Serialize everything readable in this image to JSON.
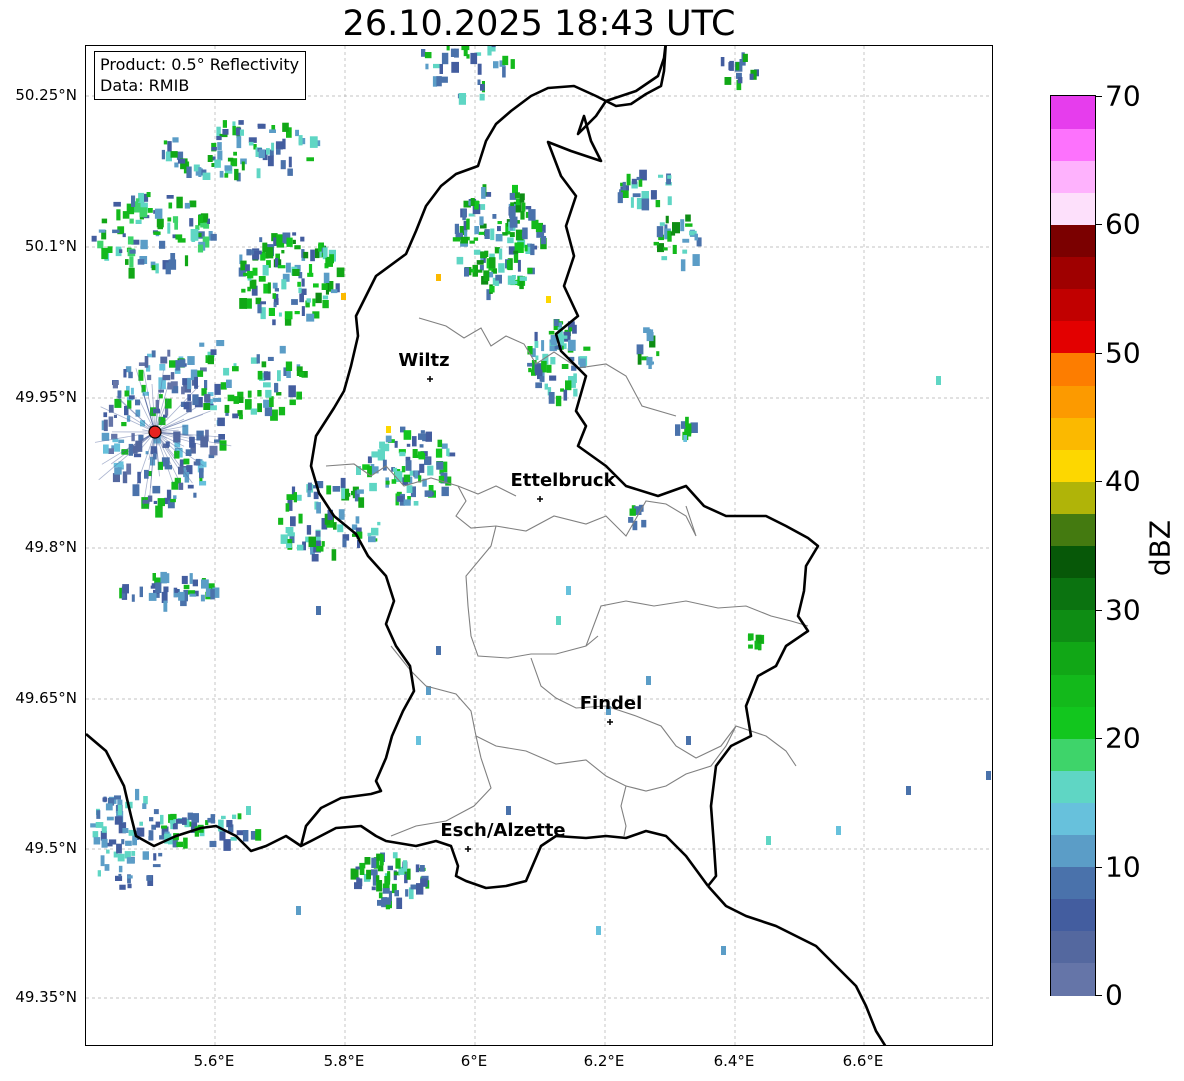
{
  "title": "26.10.2025 18:43 UTC",
  "info": {
    "product": "Product: 0.5° Reflectivity",
    "source": "Data: RMIB"
  },
  "axes": {
    "lat_ticks": [
      "50.25°N",
      "50.1°N",
      "49.95°N",
      "49.8°N",
      "49.65°N",
      "49.5°N",
      "49.35°N"
    ],
    "lon_ticks": [
      "5.6°E",
      "5.8°E",
      "6°E",
      "6.2°E",
      "6.4°E",
      "6.6°E"
    ],
    "grid": true
  },
  "cities": [
    {
      "name": "Wiltz"
    },
    {
      "name": "Ettelbruck"
    },
    {
      "name": "Findel"
    },
    {
      "name": "Esch/Alzette"
    }
  ],
  "radar_site": {
    "color": "#e8231f"
  },
  "colorbar": {
    "label": "dBZ",
    "ticks": [
      "0",
      "10",
      "20",
      "30",
      "40",
      "50",
      "60",
      "70"
    ],
    "range": [
      0,
      70
    ],
    "colors": [
      "#6575a8",
      "#54689f",
      "#435d9f",
      "#4a72ab",
      "#5b9dc7",
      "#67c1dc",
      "#5fd6c4",
      "#3ed46a",
      "#12c61e",
      "#13b91b",
      "#11a716",
      "#0e8d14",
      "#0b7310",
      "#075808",
      "#447a10",
      "#b0b408",
      "#fdd700",
      "#fbb900",
      "#fc9a00",
      "#fd7d00",
      "#e30000",
      "#c10000",
      "#9f0000",
      "#7b0000",
      "#fde0fb",
      "#feb2fd",
      "#fd72fd",
      "#e63ded"
    ]
  },
  "colors": {
    "border": "#000000",
    "district": "#808080",
    "grid": "#b0b0b0"
  }
}
